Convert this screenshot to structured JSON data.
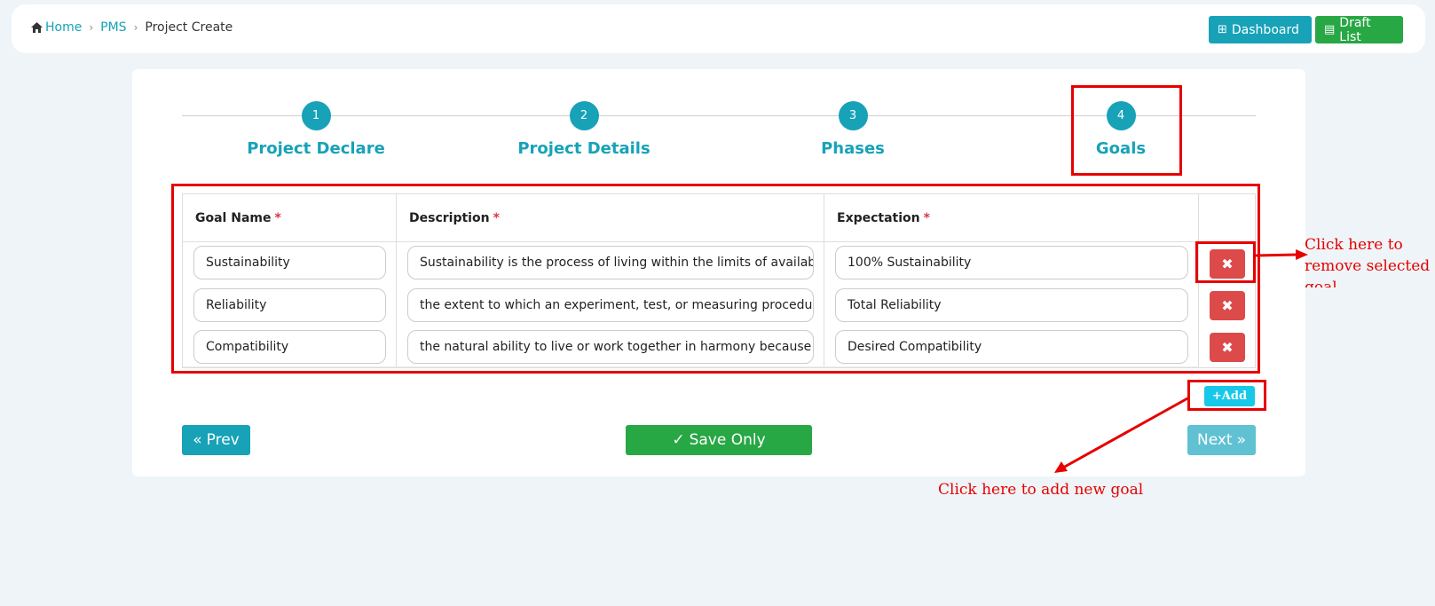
{
  "breadcrumb": {
    "home": "Home",
    "pms": "PMS",
    "current": "Project Create"
  },
  "header_buttons": {
    "dashboard": "Dashboard",
    "draft_list": "Draft List"
  },
  "steps": [
    {
      "number": "1",
      "label": "Project Declare"
    },
    {
      "number": "2",
      "label": "Project Details"
    },
    {
      "number": "3",
      "label": "Phases"
    },
    {
      "number": "4",
      "label": "Goals"
    }
  ],
  "table": {
    "headers": {
      "goal_name": "Goal Name",
      "description": "Description",
      "expectation": "Expectation",
      "required_mark": "*"
    },
    "rows": [
      {
        "goal_name": "Sustainability",
        "description": "Sustainability is the process of living within the limits of available",
        "expectation": "100% Sustainability"
      },
      {
        "goal_name": "Reliability",
        "description": "the extent to which an experiment, test, or measuring procedure",
        "expectation": "Total Reliability"
      },
      {
        "goal_name": "Compatibility",
        "description": "the natural ability to live or work together in harmony because c",
        "expectation": "Desired Compatibility"
      }
    ],
    "remove_icon": "✖"
  },
  "actions": {
    "add": "+Add",
    "prev": "Prev",
    "save": "Save Only",
    "next": "Next"
  },
  "annotations": {
    "remove_note": "Click here to remove selected goal",
    "add_note": "Click here to add new goal"
  },
  "colors": {
    "primary": "#17a2b8",
    "success": "#28a745",
    "danger": "#dc4a4a",
    "annotation": "#e60000"
  }
}
